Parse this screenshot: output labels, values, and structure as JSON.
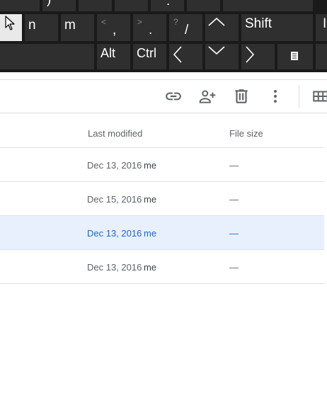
{
  "keyboard": {
    "row2": [
      {
        "main": "n"
      },
      {
        "main": "m"
      },
      {
        "main": ",",
        "sub": "<"
      },
      {
        "main": ".",
        "sub": ">"
      },
      {
        "main": "/",
        "sub": "?"
      },
      {
        "icon": "arrow-up-icon"
      },
      {
        "main": "Shift"
      }
    ],
    "row3": [
      {
        "main": "Alt"
      },
      {
        "main": "Ctrl"
      },
      {
        "icon": "arrow-left-icon"
      },
      {
        "icon": "arrow-down-icon"
      },
      {
        "icon": "arrow-right-icon"
      },
      {
        "icon": "context-menu-icon"
      }
    ],
    "top_partial": [
      {
        "main": ")"
      },
      {
        "main": ":"
      }
    ]
  },
  "toolbar": {
    "icons": [
      "link-icon",
      "add-person-icon",
      "trash-icon",
      "more-vert-icon",
      "grid-view-icon"
    ]
  },
  "file_list": {
    "columns": {
      "last_modified": "Last modified",
      "file_size": "File size"
    },
    "rows": [
      {
        "date": "Dec 13, 2016",
        "owner": "me",
        "size": "—",
        "selected": false
      },
      {
        "date": "Dec 15, 2016",
        "owner": "me",
        "size": "—",
        "selected": false
      },
      {
        "date": "Dec 13, 2016",
        "owner": "me",
        "size": "—",
        "selected": true
      },
      {
        "date": "Dec 13, 2016",
        "owner": "me",
        "size": "—",
        "selected": false
      }
    ]
  },
  "colors": {
    "keyboard_bg": "#1a1a1a",
    "key_bg": "#2f2f2f",
    "selected_row_bg": "#e8f0fe",
    "selected_text": "#1967d2",
    "icon_gray": "#5f6368"
  }
}
